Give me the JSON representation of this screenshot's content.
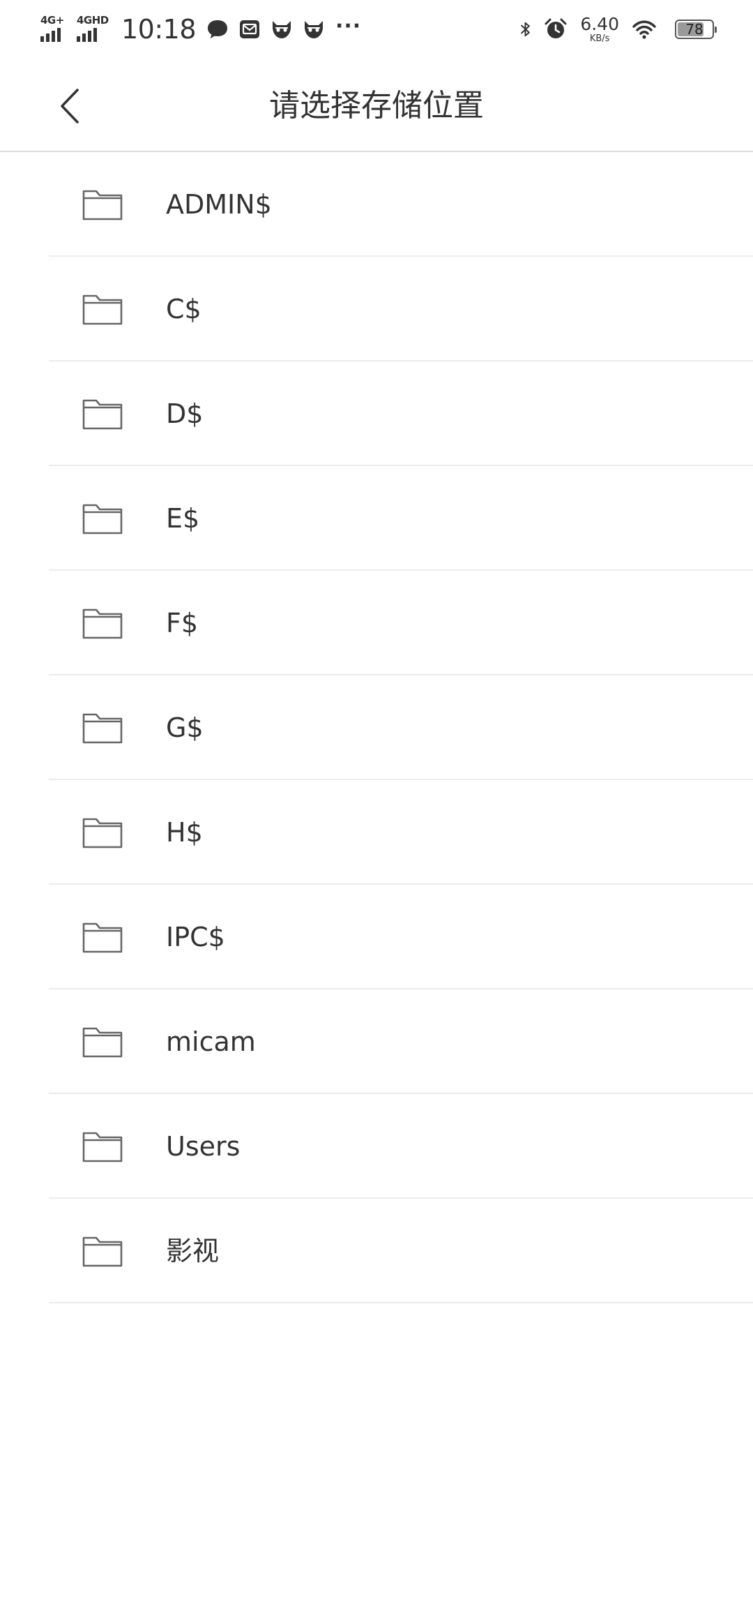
{
  "status_bar": {
    "network1": "4G+",
    "network2": "4GHD",
    "time": "10:18",
    "speed_value": "6.40",
    "speed_unit": "KB/s",
    "battery": "78",
    "battery_level": 0.78,
    "more": "···",
    "icons": [
      "chat-bubble-icon",
      "mail-icon",
      "app-mascot-icon",
      "app-mascot-icon",
      "bluetooth-icon",
      "alarm-icon",
      "wifi-icon",
      "battery-icon"
    ]
  },
  "header": {
    "back_icon": "chevron-left-icon",
    "title": "请选择存储位置"
  },
  "folders": [
    {
      "name": "ADMIN$"
    },
    {
      "name": "C$"
    },
    {
      "name": "D$"
    },
    {
      "name": "E$"
    },
    {
      "name": "F$"
    },
    {
      "name": "G$"
    },
    {
      "name": "H$"
    },
    {
      "name": "IPC$"
    },
    {
      "name": "micam"
    },
    {
      "name": "Users"
    },
    {
      "name": "影视"
    }
  ],
  "colors": {
    "text": "#333333",
    "icon_stroke": "#666666",
    "divider": "#ececec",
    "background": "#ffffff"
  }
}
